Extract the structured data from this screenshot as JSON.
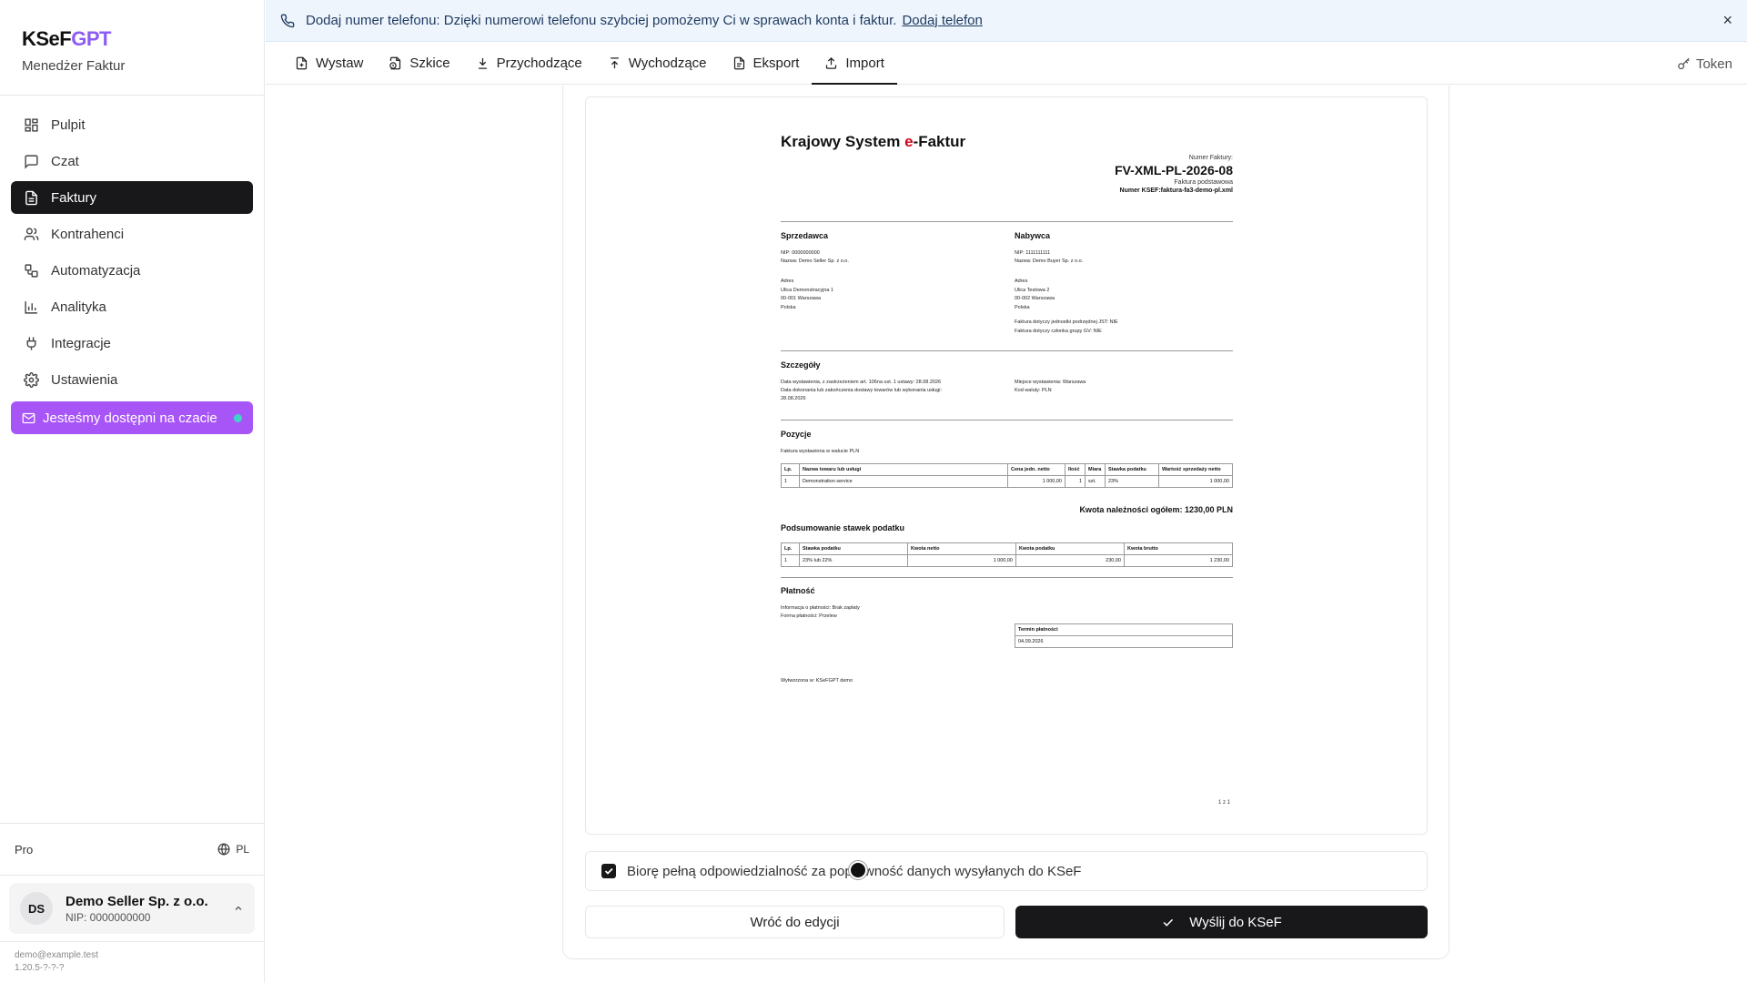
{
  "brand": {
    "name_part1": "KSeF",
    "name_part2": "GPT",
    "subtitle": "Menedżer Faktur"
  },
  "sidebar": {
    "items": [
      {
        "label": "Pulpit",
        "icon": "grid-icon"
      },
      {
        "label": "Czat",
        "icon": "chat-icon"
      },
      {
        "label": "Faktury",
        "icon": "document-icon",
        "active": true
      },
      {
        "label": "Kontrahenci",
        "icon": "users-icon"
      },
      {
        "label": "Automatyzacja",
        "icon": "workflow-icon"
      },
      {
        "label": "Analityka",
        "icon": "bar-chart-icon"
      },
      {
        "label": "Integracje",
        "icon": "plug-icon"
      },
      {
        "label": "Ustawienia",
        "icon": "gear-icon"
      }
    ],
    "chat_cta": "Jesteśmy dostępni na czacie",
    "plan": "Pro",
    "language": "PL",
    "account": {
      "initials": "DS",
      "name": "Demo Seller Sp. z o.o.",
      "nip": "NIP: 0000000000"
    },
    "email": "demo@example.test",
    "version": "1.20.5-?-?-?"
  },
  "banner": {
    "text": "Dodaj numer telefonu: Dzięki numerowi telefonu szybciej pomożemy Ci w sprawach konta i faktur.",
    "link": "Dodaj telefon",
    "close": "×"
  },
  "tabs": [
    {
      "label": "Wystaw",
      "icon": "file-plus-icon"
    },
    {
      "label": "Szkice",
      "icon": "draft-icon"
    },
    {
      "label": "Przychodzące",
      "icon": "download-icon"
    },
    {
      "label": "Wychodzące",
      "icon": "upload-icon"
    },
    {
      "label": "Eksport",
      "icon": "file-icon"
    },
    {
      "label": "Import",
      "icon": "import-icon",
      "active": true
    }
  ],
  "token_label": "Token",
  "invoice": {
    "title_part1": "Krajowy System ",
    "title_e": "e",
    "title_part2": "-Faktur",
    "number_label": "Numer Faktury:",
    "number": "FV-XML-PL-2026-08",
    "type": "Faktura podstawowa",
    "ksef_number": "Numer KSEF:faktura-fa3-demo-pl.xml",
    "seller": {
      "title": "Sprzedawca",
      "nip": "NIP: 0000000000",
      "name": "Nazwa: Demo Seller Sp. z o.o.",
      "addr_label": "Adres",
      "street": "Ulica Demonstracyjna 1",
      "city": "00-001 Warszawa",
      "country": "Polska"
    },
    "buyer": {
      "title": "Nabywca",
      "nip": "NIP: 1111111111",
      "name": "Nazwa: Demo Buyer Sp. z o.o.",
      "addr_label": "Adres",
      "street": "Ulica Testowa 2",
      "city": "00-002 Warszawa",
      "country": "Polska",
      "jst": "Faktura dotyczy jednostki podrzędnej JST: NIE",
      "gv": "Faktura dotyczy członka grupy GV: NIE"
    },
    "details": {
      "title": "Szczegóły",
      "issue_date": "Data wystawienia, z zastrzeżeniem art. 106na ust. 1 ustawy: 28.08.2026",
      "delivery_date_1": "Data dokonania lub zakończenia dostawy towarów lub wykonania usługi:",
      "delivery_date_2": "28.08.2026",
      "place": "Miejsce wystawienia: Warszawa",
      "currency": "Kod waluty: PLN"
    },
    "items": {
      "title": "Pozycje",
      "note": "Faktura wystawiona w walucie PLN",
      "headers": [
        "Lp.",
        "Nazwa towaru lub usługi",
        "Cena jedn. netto",
        "Ilość",
        "Miara",
        "Stawka podatku",
        "Wartość sprzedaży netto"
      ],
      "rows": [
        [
          "1",
          "Demonstration service",
          "1 000,00",
          "1",
          "szt.",
          "23%",
          "1 000,00"
        ]
      ]
    },
    "total": "Kwota należności ogółem: 1230,00 PLN",
    "tax_summary": {
      "title": "Podsumowanie stawek podatku",
      "headers": [
        "Lp.",
        "Stawka podatku",
        "Kwota netto",
        "Kwota podatku",
        "Kwota brutto"
      ],
      "rows": [
        [
          "1",
          "23% lub 22%",
          "1 000,00",
          "230,00",
          "1 230,00"
        ]
      ]
    },
    "payment": {
      "title": "Płatność",
      "info": "Informacja o płatności: Brak zapłaty",
      "form": "Forma płatności: Przelew",
      "term_header": "Termin płatności",
      "term_value": "04.09.2026"
    },
    "generated": "Wytworzona w: KSeFGPT demo",
    "pager": "1 z 1"
  },
  "confirm_text": "Biorę pełną odpowiedzialność za poprawność danych wysyłanych do KSeF",
  "buttons": {
    "back": "Wróć do edycji",
    "send": "Wyślij do KSeF"
  }
}
